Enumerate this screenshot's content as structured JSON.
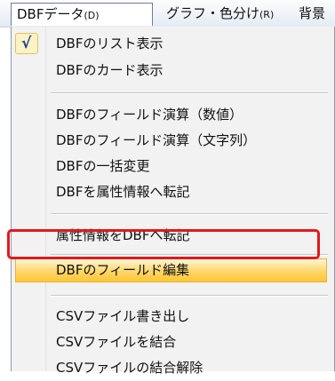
{
  "menubar": {
    "item1_main": "DBFデータ",
    "item1_key": "(D)",
    "item2_main": "グラフ・色分け",
    "item2_key": "(R)",
    "item3_main": "背景"
  },
  "menu": {
    "checkmark": "√",
    "items": [
      {
        "label": "DBFのリスト表示",
        "checked": true
      },
      {
        "label": "DBFのカード表示"
      },
      {
        "label": "DBFのフィールド演算（数値）"
      },
      {
        "label": "DBFのフィールド演算（文字列）"
      },
      {
        "label": "DBFの一括変更"
      },
      {
        "label": "DBFを属性情報へ転記"
      },
      {
        "label": "属性情報をDBFへ転記"
      },
      {
        "label": "DBFのフィールド編集",
        "highlighted": true
      },
      {
        "label": "CSVファイル書き出し"
      },
      {
        "label": "CSVファイルを結合"
      },
      {
        "label": "CSVファイルの結合解除"
      }
    ]
  },
  "colors": {
    "hover_highlight": "#ffd66b",
    "annotation_ring": "#e1191e",
    "checkmark": "#1e3d8e"
  }
}
